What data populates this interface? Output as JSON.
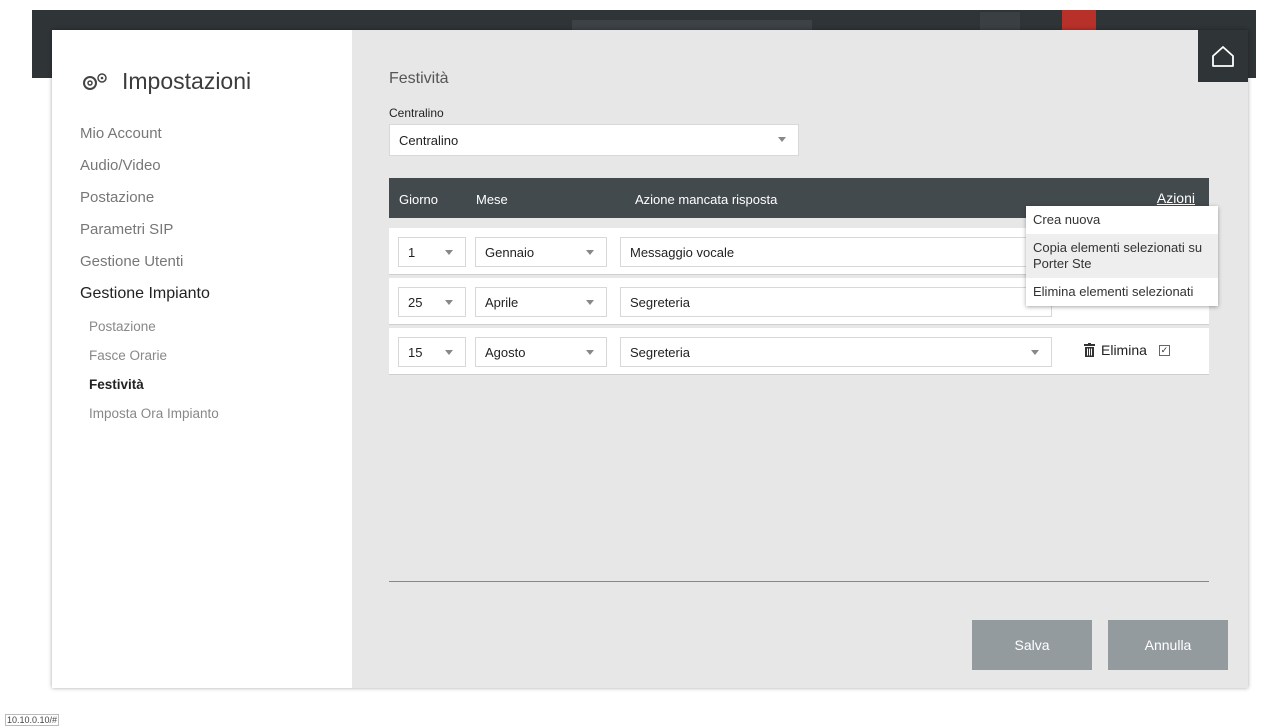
{
  "sidebar": {
    "title": "Impostazioni",
    "items": [
      {
        "label": "Mio Account"
      },
      {
        "label": "Audio/Video"
      },
      {
        "label": "Postazione"
      },
      {
        "label": "Parametri SIP"
      },
      {
        "label": "Gestione Utenti"
      },
      {
        "label": "Gestione Impianto",
        "active": true
      }
    ],
    "sub_items": [
      {
        "label": "Postazione"
      },
      {
        "label": "Fasce Orarie"
      },
      {
        "label": "Festività",
        "active": true
      },
      {
        "label": "Imposta Ora Impianto"
      }
    ]
  },
  "page": {
    "title": "Festività",
    "centralino_label": "Centralino",
    "centralino_value": "Centralino"
  },
  "table": {
    "headers": {
      "day": "Giorno",
      "month": "Mese",
      "action": "Azione mancata risposta",
      "actions": "Azioni"
    },
    "rows": [
      {
        "day": "1",
        "month": "Gennaio",
        "action": "Messaggio vocale"
      },
      {
        "day": "25",
        "month": "Aprile",
        "action": "Segreteria"
      },
      {
        "day": "15",
        "month": "Agosto",
        "action": "Segreteria",
        "delete_label": "Elimina",
        "checked": true
      }
    ]
  },
  "actions_menu": [
    {
      "label": "Crea nuova"
    },
    {
      "label": "Copia elementi selezionati su Porter Ste",
      "highlighted": true
    },
    {
      "label": "Elimina elementi selezionati"
    }
  ],
  "buttons": {
    "save": "Salva",
    "cancel": "Annulla"
  },
  "status": {
    "ip": "10.10.0.10/#"
  },
  "colors": {
    "header_bg": "#434a4e",
    "button_bg": "#949b9f",
    "content_bg": "#e7e7e7",
    "home_bg": "#2f3437"
  }
}
